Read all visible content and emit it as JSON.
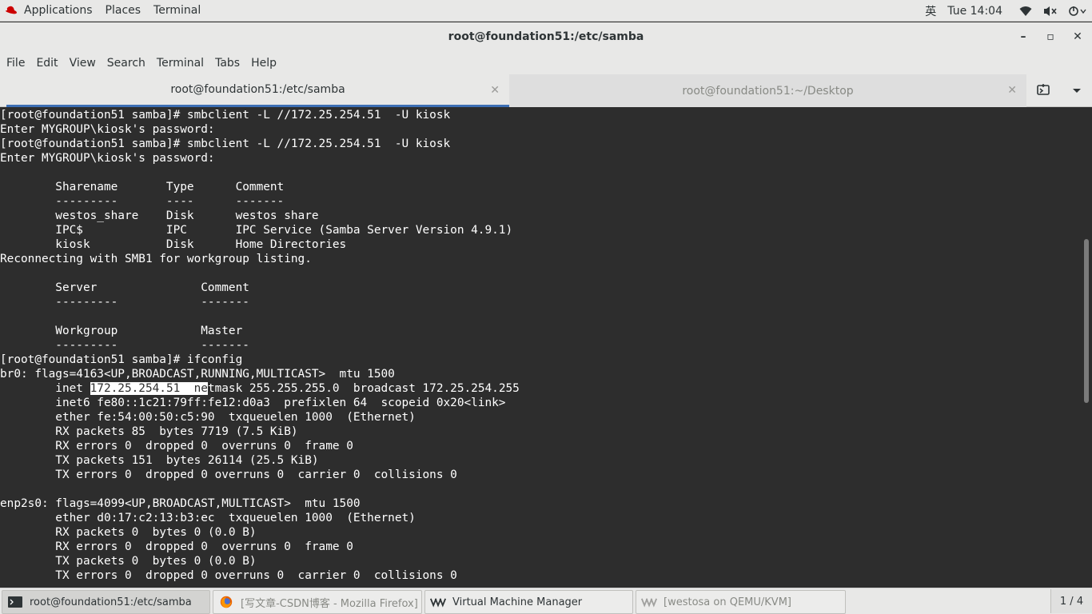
{
  "top_panel": {
    "applications": "Applications",
    "places": "Places",
    "terminal": "Terminal",
    "input_method": "英",
    "clock": "Tue 14:04",
    "icons": [
      "redhat-logo-icon",
      "wifi-icon",
      "volume-muted-icon",
      "power-icon"
    ]
  },
  "window": {
    "title": "root@foundation51:/etc/samba",
    "controls": {
      "minimize": "–",
      "maximize": "▫",
      "close": "✕"
    }
  },
  "menubar": [
    "File",
    "Edit",
    "View",
    "Search",
    "Terminal",
    "Tabs",
    "Help"
  ],
  "tabs": [
    {
      "label": "root@foundation51:/etc/samba",
      "active": true
    },
    {
      "label": "root@foundation51:~/Desktop",
      "active": false
    }
  ],
  "terminal": {
    "lines": [
      "[root@foundation51 samba]# smbclient -L //172.25.254.51  -U kiosk",
      "Enter MYGROUP\\kiosk's password: ",
      "[root@foundation51 samba]# smbclient -L //172.25.254.51  -U kiosk",
      "Enter MYGROUP\\kiosk's password: ",
      "",
      "        Sharename       Type      Comment",
      "        ---------       ----      -------",
      "        westos_share    Disk      westos share",
      "        IPC$            IPC       IPC Service (Samba Server Version 4.9.1)",
      "        kiosk           Disk      Home Directories",
      "Reconnecting with SMB1 for workgroup listing.",
      "",
      "        Server               Comment",
      "        ---------            -------",
      "",
      "        Workgroup            Master",
      "        ---------            -------",
      "[root@foundation51 samba]# ifconfig",
      "br0: flags=4163<UP,BROADCAST,RUNNING,MULTICAST>  mtu 1500",
      "        inet 172.25.254.51  netmask 255.255.255.0  broadcast 172.25.254.255",
      "        inet6 fe80::1c21:79ff:fe12:d0a3  prefixlen 64  scopeid 0x20<link>",
      "        ether fe:54:00:50:c5:90  txqueuelen 1000  (Ethernet)",
      "        RX packets 85  bytes 7719 (7.5 KiB)",
      "        RX errors 0  dropped 0  overruns 0  frame 0",
      "        TX packets 151  bytes 26114 (25.5 KiB)",
      "        TX errors 0  dropped 0 overruns 0  carrier 0  collisions 0",
      "",
      "enp2s0: flags=4099<UP,BROADCAST,MULTICAST>  mtu 1500",
      "        ether d0:17:c2:13:b3:ec  txqueuelen 1000  (Ethernet)",
      "        RX packets 0  bytes 0 (0.0 B)",
      "        RX errors 0  dropped 0  overruns 0  frame 0",
      "        TX packets 0  bytes 0 (0.0 B)",
      "        TX errors 0  dropped 0 overruns 0  carrier 0  collisions 0"
    ],
    "selection": {
      "line_index": 19,
      "before": "        inet ",
      "selected": "172.25.254.51  ne",
      "after": "tmask 255.255.255.0  broadcast 172.25.254.255"
    }
  },
  "taskbar": {
    "items": [
      {
        "label": "root@foundation51:/etc/samba",
        "icon": "terminal-icon",
        "active": true
      },
      {
        "label": "[写文章-CSDN博客 - Mozilla Firefox]",
        "icon": "firefox-icon",
        "active": false
      },
      {
        "label": "Virtual Machine Manager",
        "icon": "virt-manager-icon",
        "active": false
      },
      {
        "label": "[westosa on QEMU/KVM]",
        "icon": "virt-manager-icon",
        "active": false
      }
    ],
    "workspace": "1 / 4"
  }
}
